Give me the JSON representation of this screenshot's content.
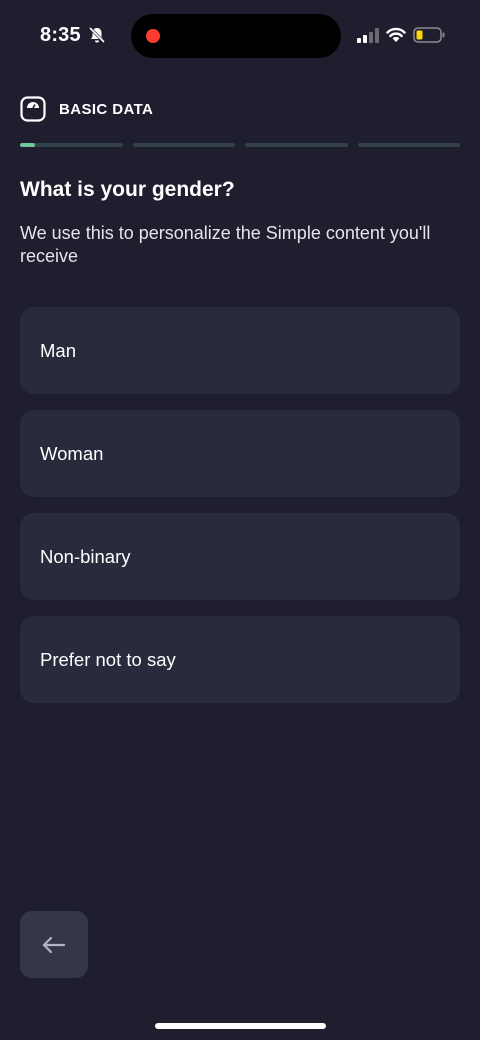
{
  "status_bar": {
    "time": "8:35",
    "icons": [
      "bell-slash-icon",
      "signal-icon",
      "wifi-icon",
      "battery-low-icon"
    ],
    "recording_color": "#ff3b30",
    "battery_color": "#ffd60a"
  },
  "header": {
    "icon": "scale-icon",
    "title": "BASIC DATA"
  },
  "progress": {
    "steps": 4,
    "current_step": 1,
    "current_step_fraction": 0.15,
    "accent_color": "#6fc99a"
  },
  "question": {
    "title": "What is your gender?",
    "subtitle": "We use this to personalize the Simple content you'll receive"
  },
  "options": [
    {
      "label": "Man"
    },
    {
      "label": "Woman"
    },
    {
      "label": "Non-binary"
    },
    {
      "label": "Prefer not to say"
    }
  ],
  "navigation": {
    "back_icon": "arrow-left-icon"
  },
  "colors": {
    "background": "#1e1e2e",
    "card": "#292a3c"
  }
}
